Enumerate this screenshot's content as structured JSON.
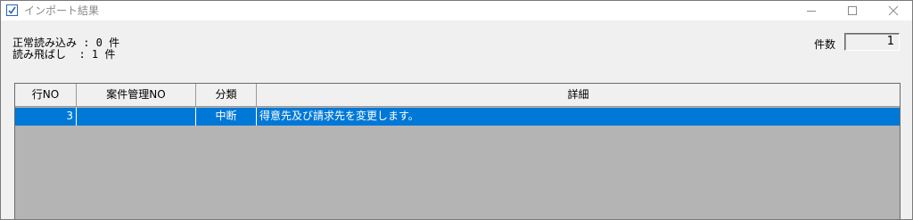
{
  "window": {
    "title": "インポート結果"
  },
  "summary": {
    "normal_read": "正常読み込み : 0 件",
    "skipped": "読み飛ばし  : 1 件"
  },
  "count": {
    "label": "件数",
    "value": "1"
  },
  "table": {
    "columns": [
      "行NO",
      "案件管理NO",
      "分類",
      "詳細"
    ],
    "rows": [
      {
        "row_no": "3",
        "case_no": "",
        "category": "中断",
        "detail": "得意先及び請求先を変更します。",
        "selected": true
      }
    ]
  },
  "colors": {
    "selection": "#0078d7",
    "grid_background": "#b4b4b4",
    "window_background": "#f0f0f0"
  },
  "icons": {
    "app": "import-result-icon",
    "minimize": "minimize-icon",
    "maximize": "maximize-icon",
    "close": "close-icon"
  }
}
